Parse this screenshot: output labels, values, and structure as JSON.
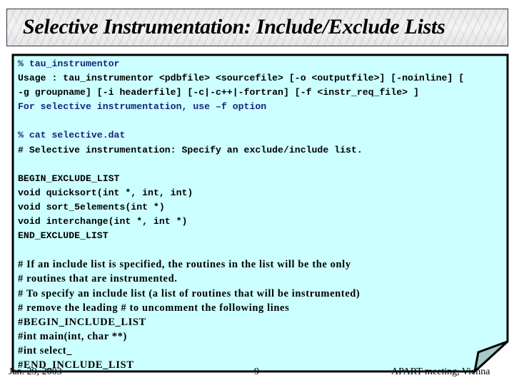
{
  "slide": {
    "title": "Selective Instrumentation: Include/Exclude Lists",
    "colors": {
      "note_background": "#ccffff",
      "note_border": "#000000",
      "curl_fill": "#a9c9c9",
      "prompt_text": "#1a237e",
      "code_text": "#000000"
    },
    "code_lines": [
      {
        "text": "% tau_instrumentor",
        "style": "blue"
      },
      {
        "text": "Usage : tau_instrumentor <pdbfile> <sourcefile> [-o <outputfile>] [-noinline] [",
        "style": "mono"
      },
      {
        "text": "-g groupname] [-i headerfile] [-c|-c++|-fortran] [-f <instr_req_file> ]",
        "style": "mono"
      },
      {
        "text": "For selective instrumentation, use –f option",
        "style": "blue"
      },
      {
        "text": "",
        "style": "mono"
      },
      {
        "text": "% cat selective.dat",
        "style": "blue"
      },
      {
        "text": "# Selective instrumentation: Specify an exclude/include list.",
        "style": "mono"
      },
      {
        "text": "",
        "style": "mono"
      },
      {
        "text": "BEGIN_EXCLUDE_LIST",
        "style": "mono"
      },
      {
        "text": "void quicksort(int *, int, int)",
        "style": "mono"
      },
      {
        "text": "void sort_5elements(int *)",
        "style": "mono"
      },
      {
        "text": "void interchange(int *, int *)",
        "style": "mono"
      },
      {
        "text": "END_EXCLUDE_LIST",
        "style": "mono"
      },
      {
        "text": "",
        "style": "mono"
      },
      {
        "text": "# If an include list is specified, the routines in the list will be the only",
        "style": "mono"
      },
      {
        "text": "# routines that are instrumented.",
        "style": "mono"
      },
      {
        "text": "# To specify an include list (a list of routines that will be instrumented)",
        "style": "mono"
      },
      {
        "text": "# remove the leading # to uncomment the following lines",
        "style": "mono"
      },
      {
        "text": "#BEGIN_INCLUDE_LIST",
        "style": "mono"
      },
      {
        "text": "#int main(int, char **)",
        "style": "mono"
      },
      {
        "text": "#int select_",
        "style": "mono"
      },
      {
        "text": "#END_INCLUDE_LIST",
        "style": "mono"
      }
    ],
    "footer": {
      "date": "Jan. 29, 2003",
      "page": "9",
      "event": "APART meeting, Vienna"
    }
  }
}
